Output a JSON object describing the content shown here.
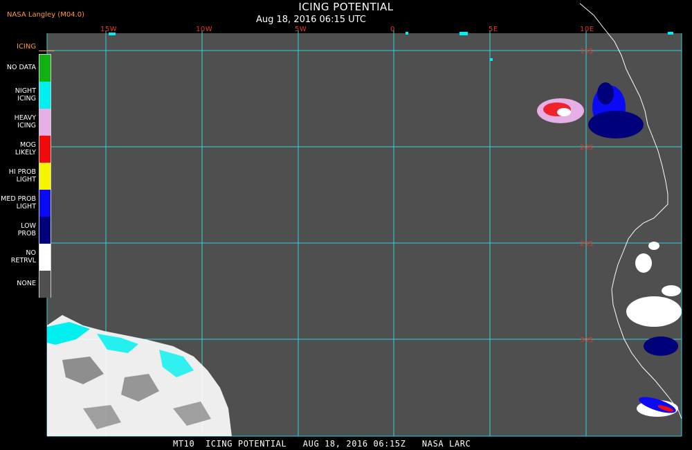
{
  "header": {
    "title": "ICING POTENTIAL",
    "subtitle": "Aug 18, 2016 06:15 UTC",
    "source": "NASA Langley (M04.0)"
  },
  "legend": {
    "heading": "ICING",
    "items": [
      {
        "label": "NO DATA",
        "color": "#12b112"
      },
      {
        "label": "NIGHT\nICING",
        "color": "#00f0f0"
      },
      {
        "label": "HEAVY\nICING",
        "color": "#e6b0e6"
      },
      {
        "label": "MOG\nLIKELY",
        "color": "#f00a0a"
      },
      {
        "label": "HI PROB\nLIGHT",
        "color": "#f5f500"
      },
      {
        "label": "MED PROB\nLIGHT",
        "color": "#0a0af5"
      },
      {
        "label": "LOW\nPROB",
        "color": "#00007a"
      },
      {
        "label": "NO\nRETRVL",
        "color": "#ffffff"
      },
      {
        "label": "NONE",
        "color": "#4f4f4f"
      }
    ]
  },
  "map": {
    "background": "#4f4f4f",
    "grid_color": "#2ed3df",
    "coast_color": "#ffffff",
    "lon_labels": [
      "15W",
      "10W",
      "5W",
      "0",
      "5E",
      "10E"
    ],
    "lat_labels": [
      "15S",
      "20S",
      "25S",
      "30S"
    ]
  },
  "footer": {
    "text": "MT10  ICING POTENTIAL   AUG 18, 2016 06:15Z   NASA LARC"
  }
}
